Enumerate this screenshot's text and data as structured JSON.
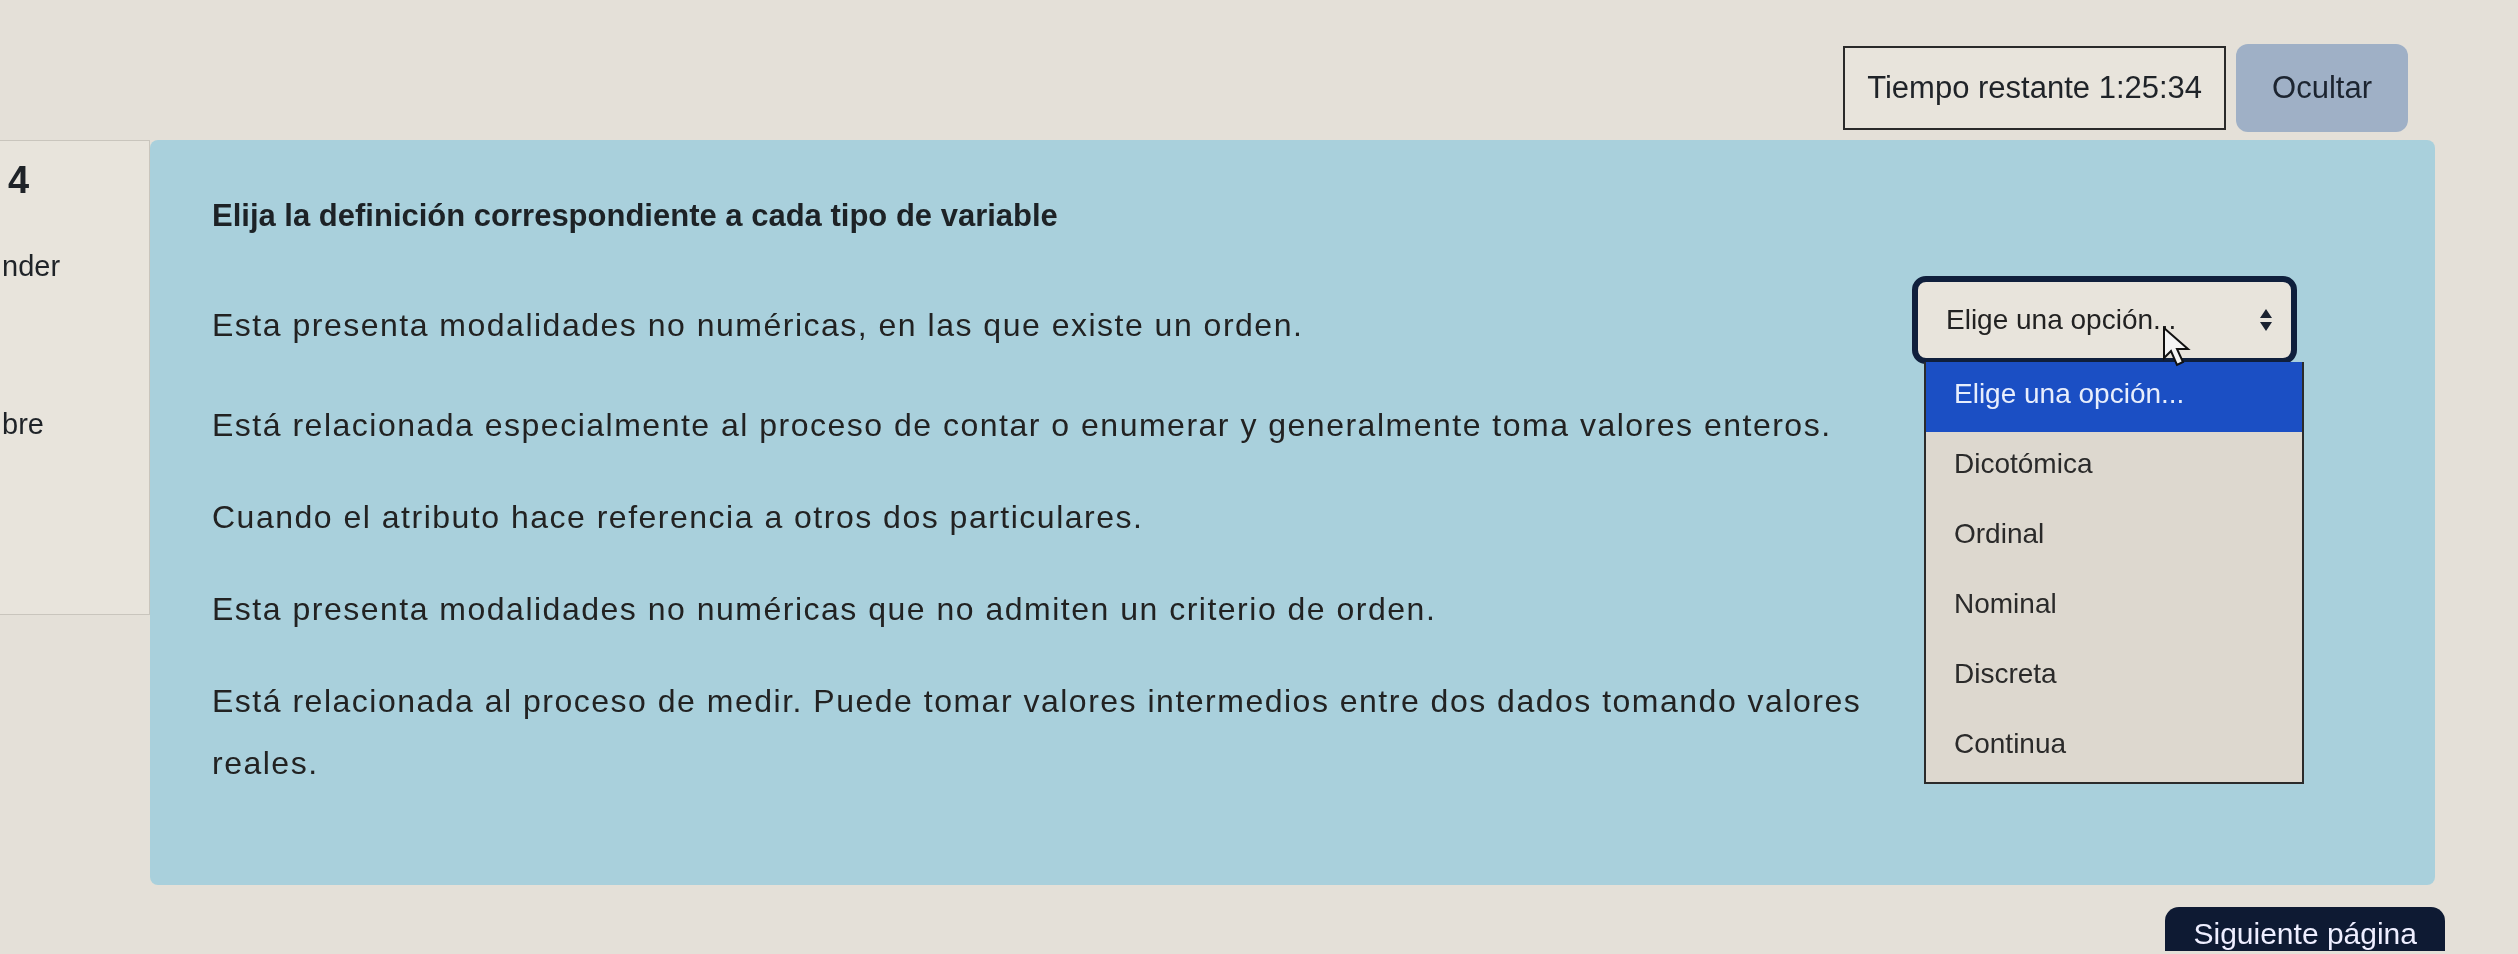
{
  "timer": "Tiempo restante 1:25:34",
  "hide_button": "Ocultar",
  "nav": {
    "number": "4",
    "fragments": [
      "nder",
      "bre"
    ]
  },
  "question": {
    "prompt": "Elija la definición correspondiente a cada tipo de variable",
    "statements": [
      {
        "text": "Esta presenta modalidades no numéricas, en las que existe un orden.",
        "select": {
          "value": "Elige una opción...",
          "expanded": true,
          "options": [
            {
              "label": "Elige una opción...",
              "selected": true
            },
            {
              "label": "Dicotómica",
              "selected": false
            },
            {
              "label": "Ordinal",
              "selected": false
            },
            {
              "label": "Nominal",
              "selected": false
            },
            {
              "label": "Discreta",
              "selected": false
            },
            {
              "label": "Continua",
              "selected": false
            }
          ]
        }
      },
      {
        "text": "Está relacionada especialmente al proceso de contar o enumerar y generalmente toma valores enteros."
      },
      {
        "text": "Cuando el atributo hace referencia a otros dos particulares."
      },
      {
        "text": "Esta presenta modalidades no numéricas que no admiten un criterio de orden."
      },
      {
        "text": "Está relacionada al proceso de medir. Puede tomar valores intermedios entre dos dados tomando valores reales."
      }
    ]
  },
  "next_button": "Siguiente página"
}
